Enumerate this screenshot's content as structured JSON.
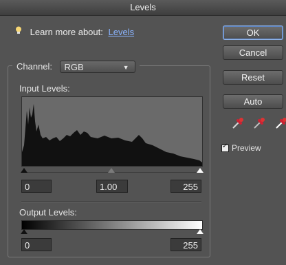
{
  "window": {
    "title": "Levels"
  },
  "help": {
    "text": "Learn more about:",
    "link": "Levels"
  },
  "buttons": {
    "ok": "OK",
    "cancel": "Cancel",
    "reset": "Reset",
    "auto": "Auto"
  },
  "channel": {
    "label": "Channel:",
    "value": "RGB"
  },
  "input_levels": {
    "title": "Input Levels:",
    "black": "0",
    "gamma": "1.00",
    "white": "255"
  },
  "output_levels": {
    "title": "Output Levels:",
    "black": "0",
    "white": "255"
  },
  "preview": {
    "label": "Preview",
    "checked": true
  },
  "icons": [
    "lightbulb-icon",
    "dropdown-arrow-icon",
    "black-eyedropper-icon",
    "gray-eyedropper-icon",
    "white-eyedropper-icon",
    "checkmark-icon"
  ]
}
